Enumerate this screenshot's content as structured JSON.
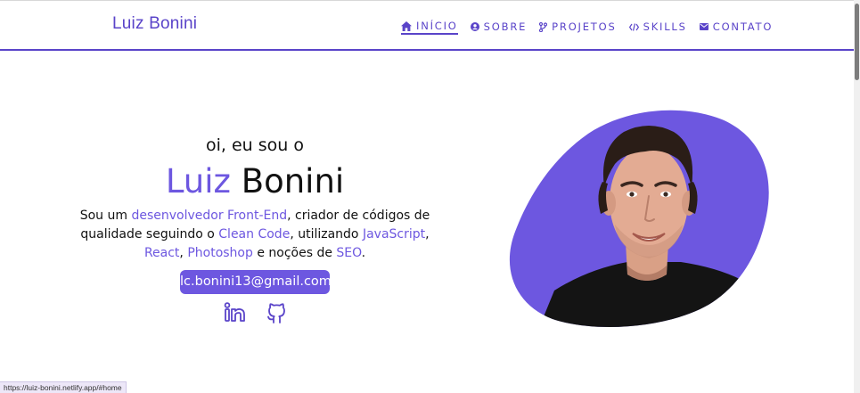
{
  "header": {
    "brand": "Luiz Bonini",
    "nav": [
      {
        "label": "Início",
        "icon": "home-icon",
        "active": true
      },
      {
        "label": "Sobre",
        "icon": "user-circle-icon",
        "active": false
      },
      {
        "label": "Projetos",
        "icon": "git-branch-icon",
        "active": false
      },
      {
        "label": "Skills",
        "icon": "code-icon",
        "active": false
      },
      {
        "label": "Contato",
        "icon": "mail-icon",
        "active": false
      }
    ]
  },
  "hero": {
    "intro": "oi, eu sou o",
    "name_first": "Luiz",
    "name_last": " Bonini",
    "description": [
      {
        "text": "Sou um ",
        "highlight": false
      },
      {
        "text": "desenvolvedor Front-End",
        "highlight": true
      },
      {
        "text": ", criador de códigos de qualidade seguindo o ",
        "highlight": false
      },
      {
        "text": "Clean Code",
        "highlight": true
      },
      {
        "text": ", utilizando ",
        "highlight": false
      },
      {
        "text": "JavaScript",
        "highlight": true
      },
      {
        "text": ", ",
        "highlight": false
      },
      {
        "text": "React",
        "highlight": true
      },
      {
        "text": ", ",
        "highlight": false
      },
      {
        "text": "Photoshop",
        "highlight": true
      },
      {
        "text": " e noções de ",
        "highlight": false
      },
      {
        "text": "SEO",
        "highlight": true
      },
      {
        "text": ".",
        "highlight": false
      }
    ],
    "email": "lc.bonini13@gmail.com",
    "socials": [
      "linkedin-icon",
      "github-icon"
    ]
  },
  "status_url": "https://luiz-bonini.netlify.app/#home",
  "colors": {
    "accent": "#6d57e0",
    "header_accent": "#5a44c9"
  }
}
